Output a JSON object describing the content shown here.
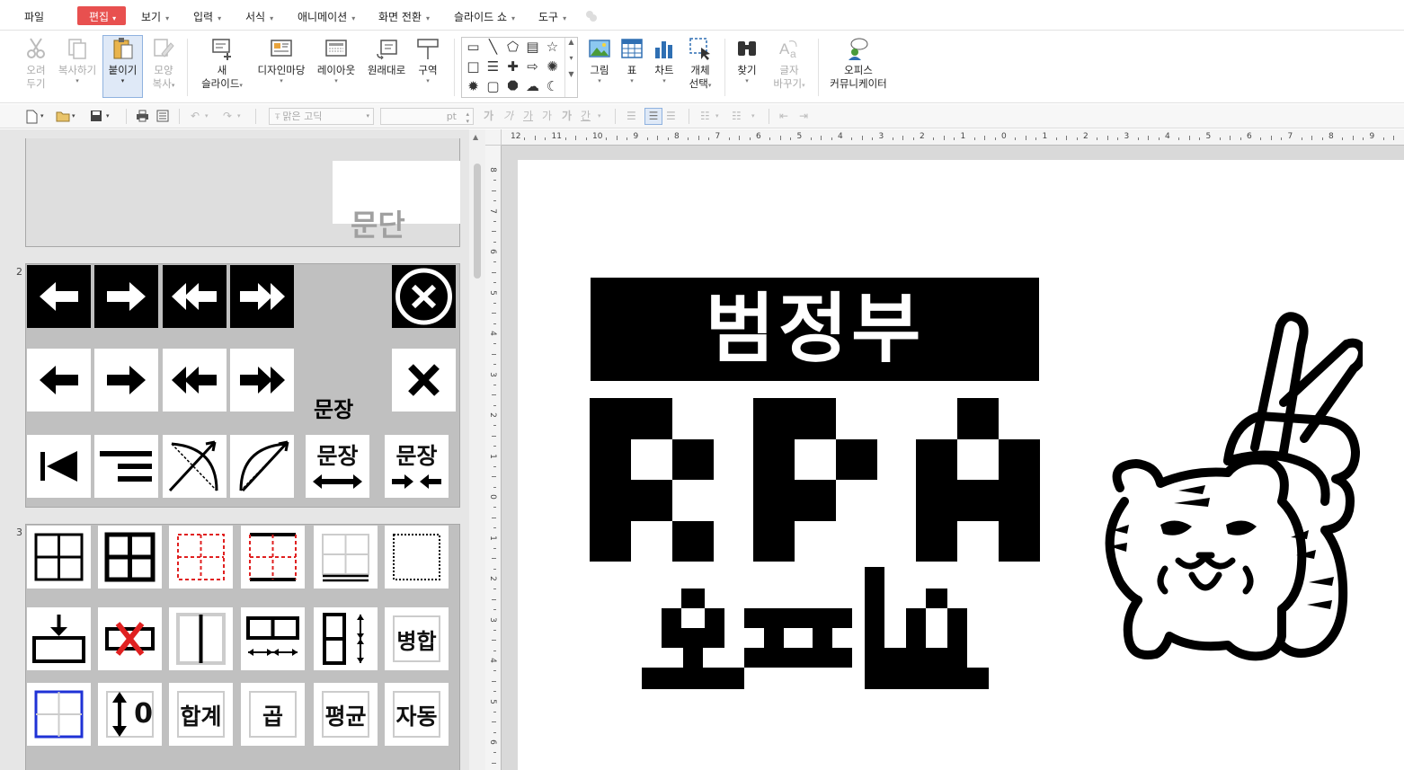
{
  "menu": {
    "file": "파일",
    "edit": "편집",
    "view": "보기",
    "input": "입력",
    "format": "서식",
    "animation": "애니메이션",
    "transition": "화면 전환",
    "slideshow": "슬라이드 쇼",
    "tools": "도구"
  },
  "ribbon": {
    "cut": [
      "오려",
      "두기"
    ],
    "copy": "복사하기",
    "paste": "붙이기",
    "format_copy": [
      "모양",
      "복사"
    ],
    "new_slide": [
      "새",
      "슬라이드"
    ],
    "design": "디자인마당",
    "layout": "레이아웃",
    "reset": "원래대로",
    "section": "구역",
    "picture": "그림",
    "table": "표",
    "chart": "차트",
    "select_object": [
      "개체",
      "선택"
    ],
    "find": "찾기",
    "replace_font": [
      "글자",
      "바꾸기"
    ],
    "office_comm": [
      "오피스",
      "커뮤니케이터"
    ]
  },
  "toolbar": {
    "font_name": "맑은 고딕",
    "font_size_unit": "pt",
    "font_glyphs": [
      "가",
      "가",
      "가",
      "가",
      "가",
      "간"
    ]
  },
  "thumbnails": {
    "slide1_text": "문단",
    "slide2_number": "2",
    "slide2_sentence": "문장",
    "slide2_cell1": "문장",
    "slide2_cell2": "문장",
    "slide3_number": "3",
    "slide3_merge": "병합",
    "slide3_zero": "0",
    "slide3_sum": "합계",
    "slide3_product": "곱",
    "slide3_average": "평균",
    "slide3_auto": "자동"
  },
  "slide": {
    "banner_title": "범정부"
  },
  "colors": {
    "menu_active_bg": "#e8504f",
    "thumb_bg": "#c0c0c0",
    "selected_blue": "#1f32d6",
    "red_dash": "#e02020"
  }
}
